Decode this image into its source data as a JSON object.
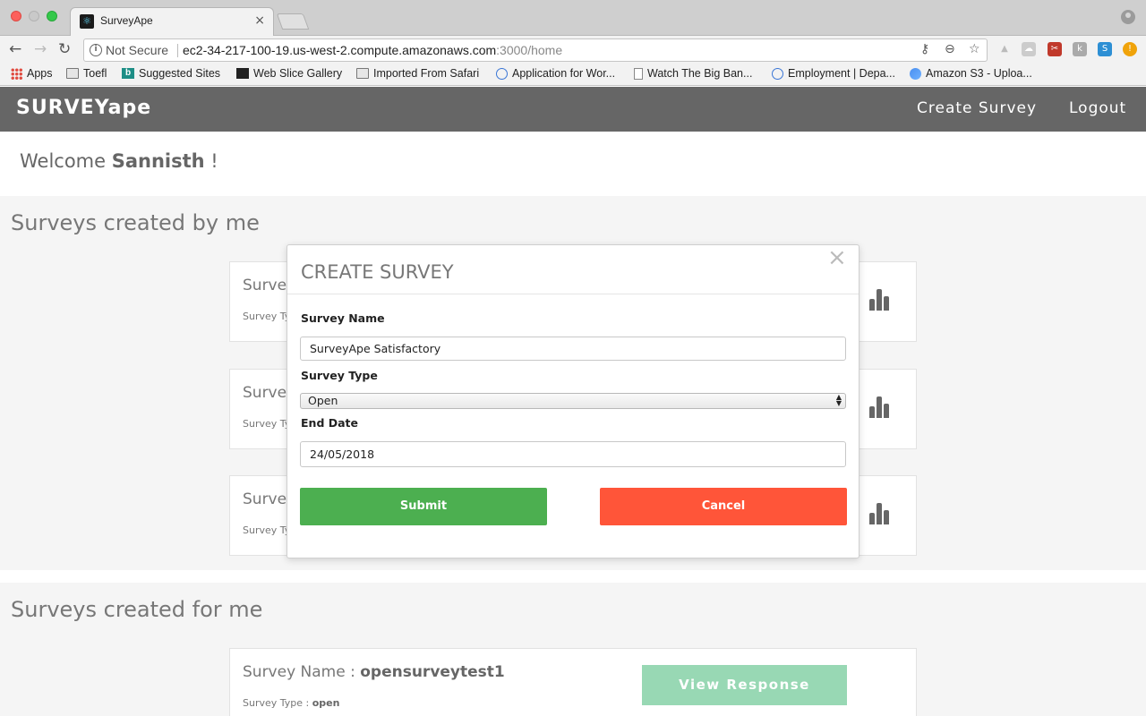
{
  "browser": {
    "tab_title": "SurveyApe",
    "tab_close": "×",
    "security_text": "Not Secure",
    "url_host": "ec2-34-217-100-19.us-west-2.compute.amazonaws.com",
    "url_path": ":3000/home",
    "bookmarks": [
      {
        "label": "Apps",
        "icon": "apps-icon"
      },
      {
        "label": "Toefl",
        "icon": "folder-icon"
      },
      {
        "label": "Suggested Sites",
        "icon": "bing-icon"
      },
      {
        "label": "Web Slice Gallery",
        "icon": "web-slice-icon"
      },
      {
        "label": "Imported From Safari",
        "icon": "folder-icon"
      },
      {
        "label": "Application for Wor...",
        "icon": "globe-icon"
      },
      {
        "label": "Watch The Big Ban...",
        "icon": "page-icon"
      },
      {
        "label": "Employment | Depa...",
        "icon": "globe-icon"
      },
      {
        "label": "Amazon S3 - Uploa...",
        "icon": "s3-icon"
      }
    ]
  },
  "app": {
    "brand": "SURVEYape",
    "nav": {
      "create": "Create Survey",
      "logout": "Logout"
    },
    "welcome": {
      "prefix": "Welcome ",
      "name": "Sannisth",
      "suffix": " !"
    }
  },
  "sections": {
    "by_me": {
      "title": "Surveys created by me",
      "cards": [
        {
          "name_prefix": "Survey",
          "type_prefix": "Survey Ty"
        },
        {
          "name_prefix": "Survey",
          "type_prefix": "Survey Ty"
        },
        {
          "name_prefix": "Survey",
          "type_prefix": "Survey Ty"
        }
      ]
    },
    "for_me": {
      "title": "Surveys created for me",
      "cards": [
        {
          "name_label": "Survey Name : ",
          "name_value": "opensurveytest1",
          "type_label": "Survey Type : ",
          "type_value": "open",
          "button": "View Response"
        }
      ]
    }
  },
  "modal": {
    "title": "CREATE SURVEY",
    "close": "×",
    "fields": {
      "name_label": "Survey Name",
      "name_value": "SurveyApe Satisfactory",
      "type_label": "Survey Type",
      "type_value": "Open",
      "date_label": "End Date",
      "date_value": "24/05/2018"
    },
    "buttons": {
      "submit": "Submit",
      "cancel": "Cancel"
    }
  },
  "colors": {
    "navbar": "#666666",
    "submit": "#4caf50",
    "cancel": "#ff5539",
    "view_response": "#98d8b4"
  }
}
